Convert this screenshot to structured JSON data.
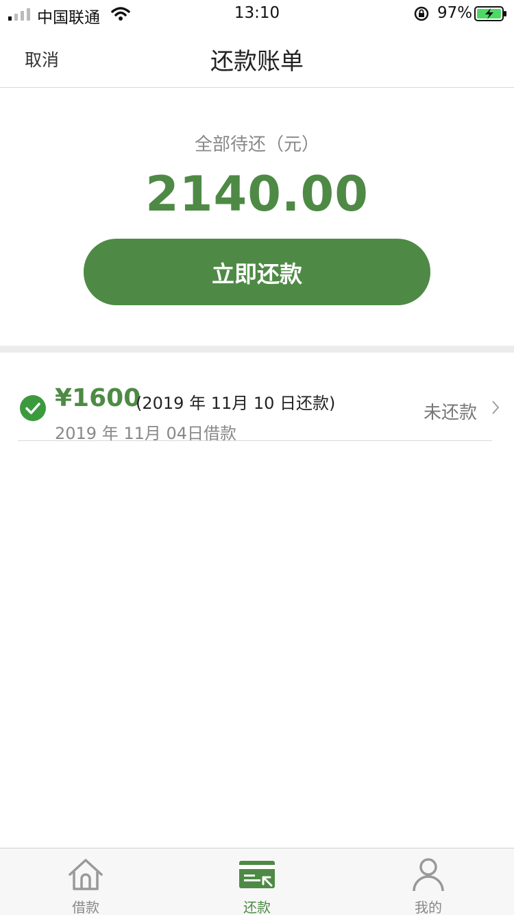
{
  "status_bar": {
    "carrier": "中国联通",
    "time": "13:10",
    "battery_percent": "97%",
    "icons": [
      "signal-icon",
      "wifi-icon",
      "orientation-lock-icon",
      "battery-charging-icon"
    ]
  },
  "nav": {
    "cancel_label": "取消",
    "title": "还款账单"
  },
  "summary": {
    "label": "全部待还（元）",
    "amount": "2140.00",
    "pay_button_label": "立即还款"
  },
  "bills": [
    {
      "amount": "¥1600",
      "due_text": "(2019 年 11月 10 日还款)",
      "borrow_date": "2019 年 11月 04日借款",
      "status": "未还款",
      "icon": "check-circle-icon"
    }
  ],
  "tabs": [
    {
      "label": "借款",
      "icon": "home-icon",
      "active": false
    },
    {
      "label": "还款",
      "icon": "repayment-card-icon",
      "active": true
    },
    {
      "label": "我的",
      "icon": "user-icon",
      "active": false
    }
  ],
  "colors": {
    "accent": "#4e8a45",
    "muted_text": "#888888",
    "divider": "#ececec"
  }
}
